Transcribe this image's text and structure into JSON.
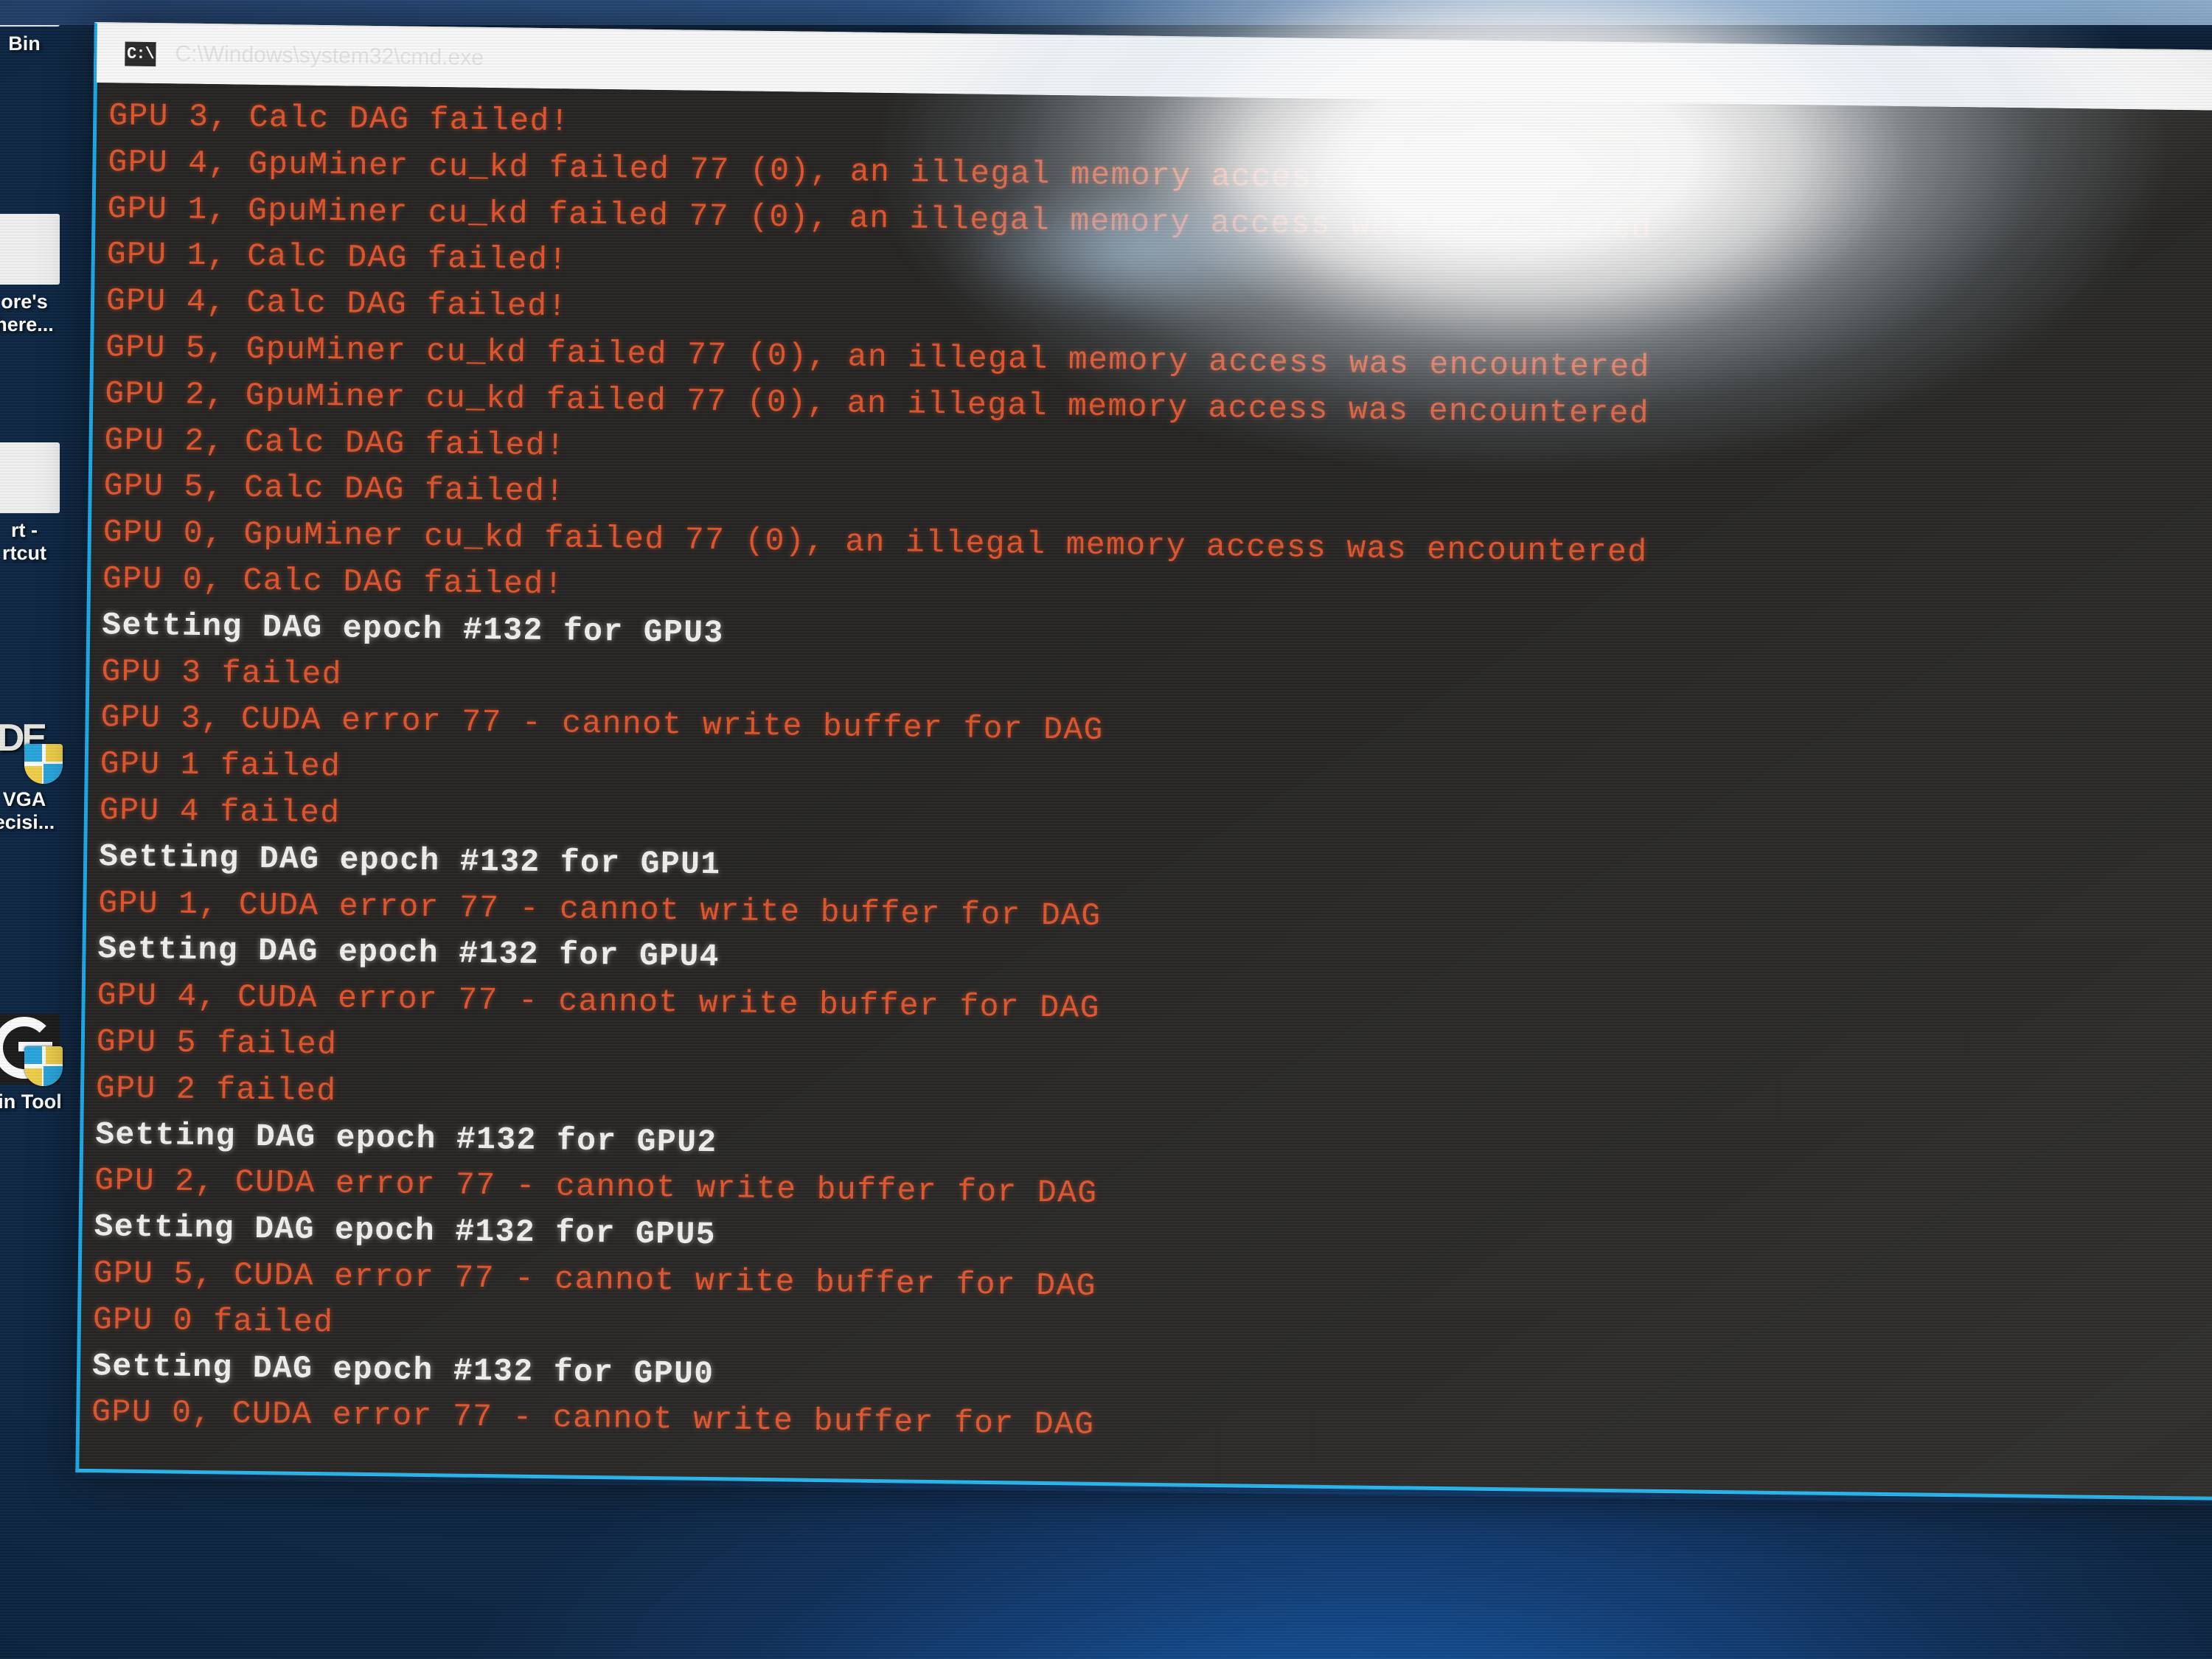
{
  "window": {
    "app_name": "cmd.exe",
    "title": "C:\\Windows\\system32\\cmd.exe",
    "icon_glyph": "C:\\",
    "icon_name": "cmd-window-icon",
    "border_color": "#1ba9e8",
    "background_color": "#262523"
  },
  "desktop": {
    "background_color": "#13417c",
    "icons": [
      {
        "name": "recycle-bin",
        "label": "Bin",
        "glyph_style": "white-tile",
        "has_shield": false
      },
      {
        "name": "text-note",
        "label": "ore's\nhere...",
        "glyph_style": "white-tile",
        "has_shield": false
      },
      {
        "name": "start-shortcut",
        "label": "rt -\nrtcut",
        "glyph_style": "white-tile",
        "has_shield": false
      },
      {
        "name": "amd-vga-driver",
        "label": "VGA\necisi...",
        "glyph_style": "amd-mark",
        "has_shield": true
      },
      {
        "name": "skin-tool",
        "label": "kin Tool",
        "glyph_style": "g-mark",
        "has_shield": true
      }
    ]
  },
  "console": {
    "text_color_error": "#e2552e",
    "text_color_info": "#f4f2ee",
    "lines": [
      {
        "type": "err",
        "text": "GPU 3, Calc DAG failed!"
      },
      {
        "type": "err",
        "text": "GPU 4, GpuMiner cu_kd failed 77 (0), an illegal memory access was encountered"
      },
      {
        "type": "err",
        "text": "GPU 1, GpuMiner cu_kd failed 77 (0), an illegal memory access was encountered"
      },
      {
        "type": "err",
        "text": "GPU 1, Calc DAG failed!"
      },
      {
        "type": "err",
        "text": "GPU 4, Calc DAG failed!"
      },
      {
        "type": "err",
        "text": "GPU 5, GpuMiner cu_kd failed 77 (0), an illegal memory access was encountered"
      },
      {
        "type": "err",
        "text": "GPU 2, GpuMiner cu_kd failed 77 (0), an illegal memory access was encountered"
      },
      {
        "type": "err",
        "text": "GPU 2, Calc DAG failed!"
      },
      {
        "type": "err",
        "text": "GPU 5, Calc DAG failed!"
      },
      {
        "type": "err",
        "text": "GPU 0, GpuMiner cu_kd failed 77 (0), an illegal memory access was encountered"
      },
      {
        "type": "err",
        "text": "GPU 0, Calc DAG failed!"
      },
      {
        "type": "info",
        "text": "Setting DAG epoch #132 for GPU3"
      },
      {
        "type": "err",
        "text": "GPU 3 failed"
      },
      {
        "type": "err",
        "text": "GPU 3, CUDA error 77 - cannot write buffer for DAG"
      },
      {
        "type": "err",
        "text": "GPU 1 failed"
      },
      {
        "type": "err",
        "text": "GPU 4 failed"
      },
      {
        "type": "info",
        "text": "Setting DAG epoch #132 for GPU1"
      },
      {
        "type": "err",
        "text": "GPU 1, CUDA error 77 - cannot write buffer for DAG"
      },
      {
        "type": "info",
        "text": "Setting DAG epoch #132 for GPU4"
      },
      {
        "type": "err",
        "text": "GPU 4, CUDA error 77 - cannot write buffer for DAG"
      },
      {
        "type": "err",
        "text": "GPU 5 failed"
      },
      {
        "type": "err",
        "text": "GPU 2 failed"
      },
      {
        "type": "info",
        "text": "Setting DAG epoch #132 for GPU2"
      },
      {
        "type": "err",
        "text": "GPU 2, CUDA error 77 - cannot write buffer for DAG"
      },
      {
        "type": "info",
        "text": "Setting DAG epoch #132 for GPU5"
      },
      {
        "type": "err",
        "text": "GPU 5, CUDA error 77 - cannot write buffer for DAG"
      },
      {
        "type": "err",
        "text": "GPU 0 failed"
      },
      {
        "type": "info",
        "text": "Setting DAG epoch #132 for GPU0"
      },
      {
        "type": "err",
        "text": "GPU 0, CUDA error 77 - cannot write buffer for DAG"
      }
    ]
  }
}
